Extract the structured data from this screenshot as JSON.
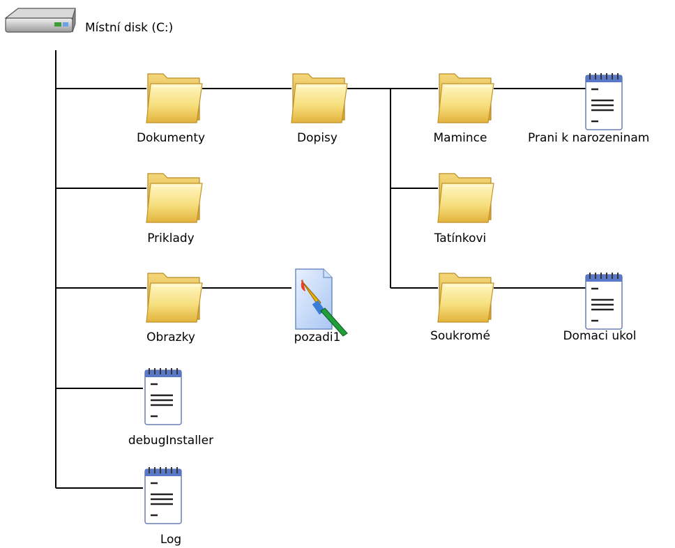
{
  "root": {
    "label": "Místní disk (C:)",
    "icon": "hard-drive-icon"
  },
  "nodes": [
    {
      "id": "dokumenty",
      "label": "Dokumenty",
      "icon": "folder-icon"
    },
    {
      "id": "dopisy",
      "label": "Dopisy",
      "icon": "folder-icon"
    },
    {
      "id": "mamince",
      "label": "Mamince",
      "icon": "folder-icon"
    },
    {
      "id": "prani",
      "label": "Prani k narozeninam",
      "icon": "notepad-document-icon"
    },
    {
      "id": "priklady",
      "label": "Priklady",
      "icon": "folder-icon"
    },
    {
      "id": "tatinkovi",
      "label": "Tatínkovi",
      "icon": "folder-icon"
    },
    {
      "id": "obrazky",
      "label": "Obrazky",
      "icon": "folder-icon"
    },
    {
      "id": "pozadi1",
      "label": "pozadi1",
      "icon": "paint-image-icon"
    },
    {
      "id": "soukrome",
      "label": "Soukromé",
      "icon": "folder-icon"
    },
    {
      "id": "domaci",
      "label": "Domaci ukol",
      "icon": "notepad-document-icon"
    },
    {
      "id": "debug",
      "label": "debugInstaller",
      "icon": "notepad-document-icon"
    },
    {
      "id": "log",
      "label": "Log",
      "icon": "notepad-document-icon"
    }
  ]
}
